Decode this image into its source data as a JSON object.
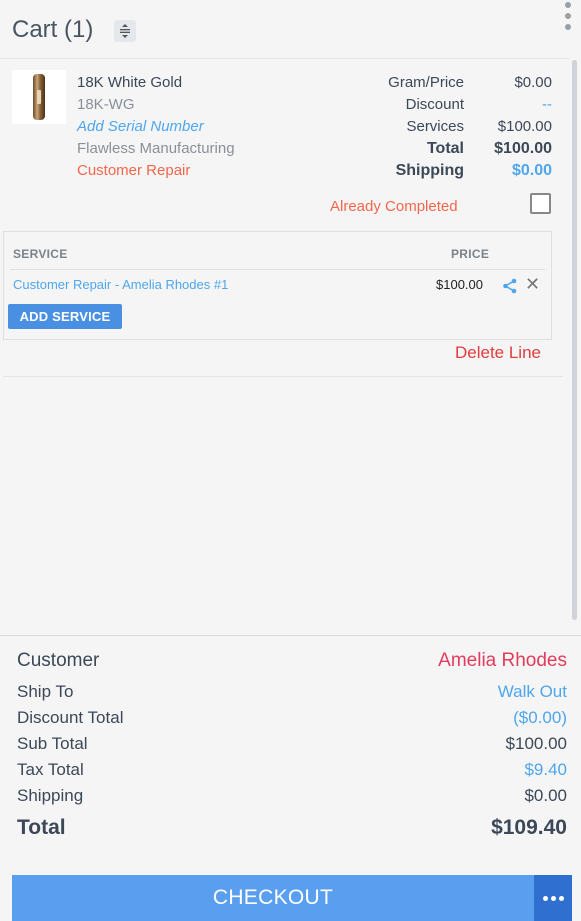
{
  "header": {
    "title": "Cart (1)"
  },
  "line_item": {
    "name": "18K White Gold",
    "sku": "18K-WG",
    "serial_link": "Add Serial Number",
    "manufacturer": "Flawless Manufacturing",
    "repair_tag": "Customer Repair",
    "labels": {
      "gram_price": "Gram/Price",
      "discount": "Discount",
      "services": "Services",
      "total": "Total",
      "shipping": "Shipping"
    },
    "values": {
      "gram_price": "$0.00",
      "discount": "--",
      "services": "$100.00",
      "total": "$100.00",
      "shipping": "$0.00"
    },
    "already_completed": "Already Completed",
    "delete_line": "Delete Line"
  },
  "services_table": {
    "col_service": "SERVICE",
    "col_price": "PRICE",
    "rows": [
      {
        "name": "Customer Repair - Amelia Rhodes #1",
        "price": "$100.00"
      }
    ],
    "add_button": "ADD SERVICE"
  },
  "summary": {
    "customer_label": "Customer",
    "customer_value": "Amelia Rhodes",
    "ship_to_label": "Ship To",
    "ship_to_value": "Walk Out",
    "discount_label": "Discount Total",
    "discount_value": "($0.00)",
    "subtotal_label": "Sub Total",
    "subtotal_value": "$100.00",
    "tax_label": "Tax Total",
    "tax_value": "$9.40",
    "shipping_label": "Shipping",
    "shipping_value": "$0.00",
    "total_label": "Total",
    "total_value": "$109.40"
  },
  "checkout": {
    "label": "CHECKOUT"
  },
  "colors": {
    "accent": "#4ea6ee",
    "danger": "#e23c3c",
    "checkout": "#5a9ef0"
  }
}
